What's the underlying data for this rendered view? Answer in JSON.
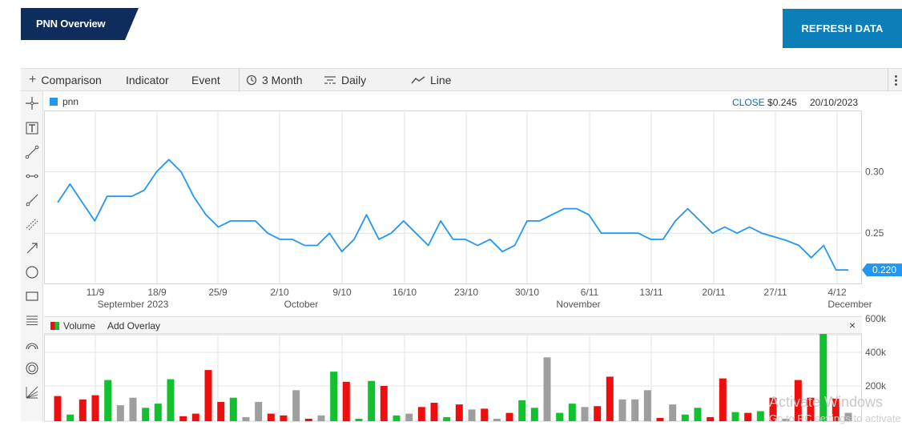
{
  "header": {
    "title": "PNN Overview",
    "refresh_label": "REFRESH DATA"
  },
  "toolbar": {
    "comparison": "Comparison",
    "indicator": "Indicator",
    "event": "Event",
    "period": "3 Month",
    "interval": "Daily",
    "chart_type": "Line"
  },
  "legend": {
    "series": "pnn"
  },
  "quote": {
    "close_label": "CLOSE",
    "close_value": "$0.245",
    "date": "20/10/2023"
  },
  "volume_panel": {
    "label": "Volume",
    "add_overlay": "Add Overlay",
    "close": "×"
  },
  "watermark": {
    "line1": "Activate Windows",
    "line2": "Go to PC settings to activate"
  },
  "colors": {
    "line": "#2196f3",
    "up": "#11c12e",
    "down": "#ef0e0e",
    "neutral": "#9e9e9e",
    "accent": "#0d7fb8",
    "title_bg": "#0f2d5c"
  },
  "chart_data": [
    {
      "type": "line",
      "series": [
        {
          "name": "pnn",
          "values": [
            0.275,
            0.29,
            0.275,
            0.26,
            0.28,
            0.28,
            0.28,
            0.285,
            0.3,
            0.31,
            0.3,
            0.28,
            0.265,
            0.255,
            0.26,
            0.26,
            0.26,
            0.25,
            0.245,
            0.245,
            0.24,
            0.24,
            0.25,
            0.235,
            0.245,
            0.265,
            0.245,
            0.25,
            0.26,
            0.25,
            0.24,
            0.26,
            0.245,
            0.245,
            0.24,
            0.245,
            0.235,
            0.24,
            0.26,
            0.26,
            0.265,
            0.27,
            0.27,
            0.265,
            0.25,
            0.25,
            0.25,
            0.25,
            0.245,
            0.245,
            0.26,
            0.27,
            0.26,
            0.25,
            0.255,
            0.25,
            0.255,
            0.25,
            0.247,
            0.244,
            0.24,
            0.23,
            0.24,
            0.22,
            0.22
          ]
        }
      ],
      "last_value_label": "0.220",
      "y_ticks": [
        "0.30",
        "0.25"
      ],
      "ylim": [
        0.209,
        0.35
      ],
      "x_ticks": [
        "11/9",
        "18/9",
        "25/9",
        "2/10",
        "9/10",
        "16/10",
        "23/10",
        "30/10",
        "6/11",
        "13/11",
        "20/11",
        "27/11",
        "4/12"
      ],
      "month_labels": [
        "September 2023",
        "October",
        "November",
        "December"
      ]
    },
    {
      "type": "bar",
      "name": "Volume",
      "values": [
        140,
        30,
        120,
        145,
        235,
        85,
        130,
        70,
        95,
        240,
        20,
        35,
        295,
        105,
        130,
        15,
        105,
        35,
        25,
        175,
        5,
        25,
        285,
        225,
        5,
        230,
        200,
        25,
        35,
        75,
        100,
        15,
        90,
        60,
        65,
        5,
        40,
        115,
        70,
        370,
        40,
        95,
        75,
        80,
        255,
        120,
        120,
        175,
        10,
        90,
        30,
        70,
        15,
        245,
        45,
        40,
        50,
        130,
        5,
        235,
        130,
        520,
        125,
        40
      ],
      "colors": [
        "down",
        "up",
        "down",
        "down",
        "up",
        "neutral",
        "neutral",
        "up",
        "up",
        "up",
        "down",
        "down",
        "down",
        "down",
        "up",
        "neutral",
        "neutral",
        "down",
        "down",
        "neutral",
        "down",
        "neutral",
        "up",
        "down",
        "up",
        "up",
        "down",
        "up",
        "neutral",
        "down",
        "down",
        "up",
        "down",
        "neutral",
        "down",
        "neutral",
        "down",
        "up",
        "up",
        "neutral",
        "up",
        "up",
        "neutral",
        "down",
        "down",
        "neutral",
        "neutral",
        "neutral",
        "down",
        "neutral",
        "up",
        "up",
        "down",
        "down",
        "up",
        "down",
        "up",
        "down",
        "neutral",
        "down",
        "down",
        "up",
        "down",
        "neutral"
      ],
      "y_ticks": [
        "600k",
        "400k",
        "200k"
      ],
      "ylim": [
        0,
        600
      ]
    }
  ]
}
